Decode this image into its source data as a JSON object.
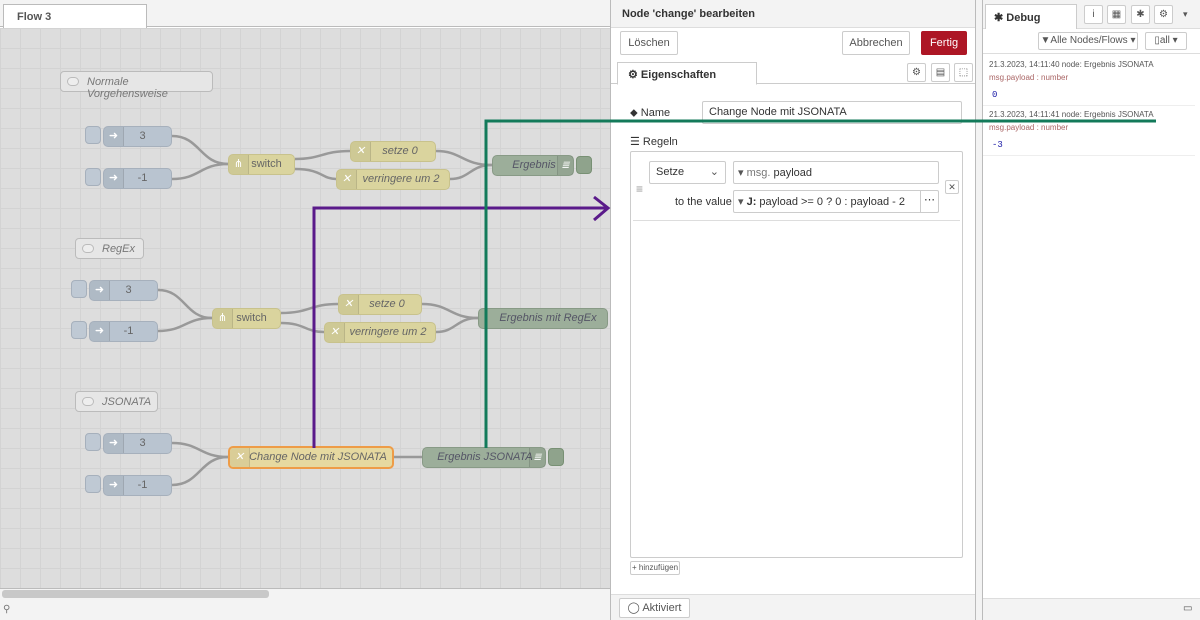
{
  "flow_tab": "Flow 3",
  "comments": [
    "Normale Vorgehensweise",
    "RegEx",
    "JSONATA"
  ],
  "groups": [
    {
      "inject_a": "3",
      "inject_b": "-1",
      "switch": "switch",
      "set": "setze 0",
      "dec": "verringere um 2",
      "debug": "Ergebnis"
    },
    {
      "inject_a": "3",
      "inject_b": "-1",
      "switch": "switch",
      "set": "setze 0",
      "dec": "verringere um 2",
      "debug": "Ergebnis mit RegEx"
    },
    {
      "inject_a": "3",
      "inject_b": "-1",
      "change": "Change Node mit JSONATA",
      "debug": "Ergebnis JSONATA"
    }
  ],
  "editor": {
    "title": "Node 'change' bearbeiten",
    "delete_label": "Löschen",
    "cancel_label": "Abbrechen",
    "done_label": "Fertig",
    "tab_label": "Eigenschaften",
    "name_label": "Name",
    "name_value": "Change Node mit JSONATA",
    "rules_label": "Regeln",
    "rule_action": "Setze",
    "rule_prefix": "msg.",
    "rule_target": "payload",
    "to_value_label": "to the value",
    "expr_prefix": "J:",
    "expression": "payload >= 0 ? 0 : payload - 2",
    "add_label": "hinzufügen",
    "enabled_label": "Aktiviert"
  },
  "debug": {
    "tab_label": "Debug",
    "filter_label": "Alle Nodes/Flows",
    "clear_label": "all",
    "messages": [
      {
        "meta": "21.3.2023, 14:11:40   node: Ergebnis JSONATA",
        "topic": "msg.payload : number",
        "value": "0"
      },
      {
        "meta": "21.3.2023, 14:11:41   node: Ergebnis JSONATA",
        "topic": "msg.payload : number",
        "value": "-3"
      }
    ]
  },
  "colors": {
    "annotation_purple": "#5a1a8a",
    "annotation_green": "#137a5a",
    "done_red": "#ad1625"
  }
}
